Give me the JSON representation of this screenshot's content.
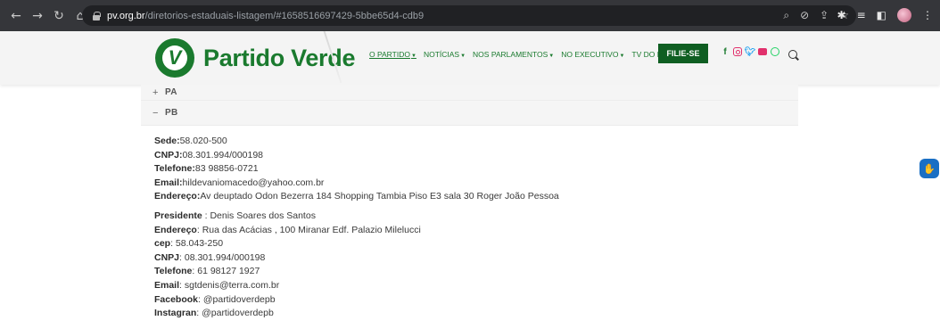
{
  "browser": {
    "url_domain": "pv.org.br",
    "url_path": "/diretorios-estaduais-listagem/#1658516697429-5bbe65d4-cdb9"
  },
  "header": {
    "logo_text": "Partido Verde",
    "logo_mark": "V",
    "nav": [
      {
        "label": "O PARTIDO",
        "has_dropdown": true
      },
      {
        "label": "NOTÍCIAS",
        "has_dropdown": true
      },
      {
        "label": "NOS PARLAMENTOS",
        "has_dropdown": true
      },
      {
        "label": "NO EXECUTIVO",
        "has_dropdown": true
      },
      {
        "label": "TV DO PV",
        "has_dropdown": false
      }
    ],
    "cta_label": "FILIE-SE",
    "brand_color": "#1a7a2e"
  },
  "accordion": {
    "pa": {
      "sign": "+",
      "label": "PA"
    },
    "pb": {
      "sign": "−",
      "label": "PB"
    },
    "pb_group1": [
      {
        "key": "Sede:",
        "value": "58.020-500"
      },
      {
        "key": "CNPJ:",
        "value": "08.301.994/000198"
      },
      {
        "key": "Telefone:",
        "value": "83 98856-0721"
      },
      {
        "key": "Email:",
        "value": "hildevaniomacedo@yahoo.com.br"
      },
      {
        "key": "Endereço:",
        "value": "Av deuptado Odon Bezerra 184 Shopping Tambia Piso E3 sala 30 Roger João Pessoa"
      }
    ],
    "pb_group2": [
      {
        "key": "Presidente",
        "value": " : Denis Soares dos Santos"
      },
      {
        "key": "Endereço",
        "value": ": Rua das Acácias , 100 Miranar Edf. Palazio Milelucci"
      },
      {
        "key": "cep",
        "value": ": 58.043-250"
      },
      {
        "key": "CNPJ",
        "value": ": 08.301.994/000198"
      },
      {
        "key": "Telefone",
        "value": ": 61 98127 1927"
      },
      {
        "key": "Email",
        "value": ": sgtdenis@terra.com.br"
      },
      {
        "key": "Facebook",
        "value": ": @partidoverdepb"
      },
      {
        "key": "Instagran",
        "value": ": @partidoverdepb"
      }
    ]
  }
}
